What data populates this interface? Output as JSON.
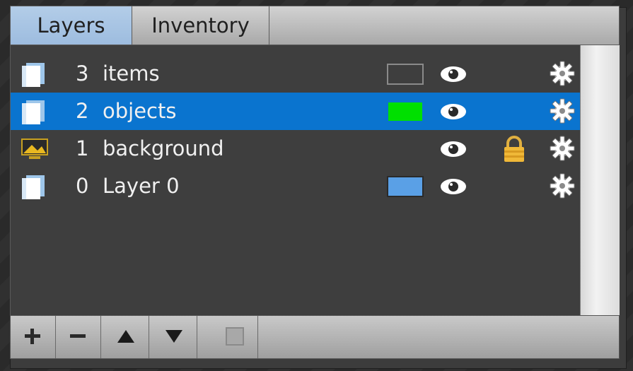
{
  "tabs": [
    {
      "label": "Layers",
      "active": true
    },
    {
      "label": "Inventory",
      "active": false
    }
  ],
  "layers": [
    {
      "index": "3",
      "name": "items",
      "icon": "layer-icon",
      "swatch_color": "#3e3e3e",
      "visible": true,
      "locked": false,
      "selected": false
    },
    {
      "index": "2",
      "name": "objects",
      "icon": "layer-icon",
      "swatch_color": "#00e000",
      "visible": true,
      "locked": false,
      "selected": true
    },
    {
      "index": "1",
      "name": "background",
      "icon": "image-layer-icon",
      "swatch_color": null,
      "visible": true,
      "locked": true,
      "selected": false
    },
    {
      "index": "0",
      "name": "Layer 0",
      "icon": "layer-icon",
      "swatch_color": "#5aa0e6",
      "visible": true,
      "locked": false,
      "selected": false
    }
  ],
  "toolbar": {
    "buttons": [
      "add-icon",
      "remove-icon",
      "move-up-icon",
      "move-down-icon",
      "properties-icon"
    ]
  },
  "colors": {
    "selection": "#0a74cf",
    "active_tab": "#a9c6e6",
    "list_background": "#3e3e3e"
  }
}
